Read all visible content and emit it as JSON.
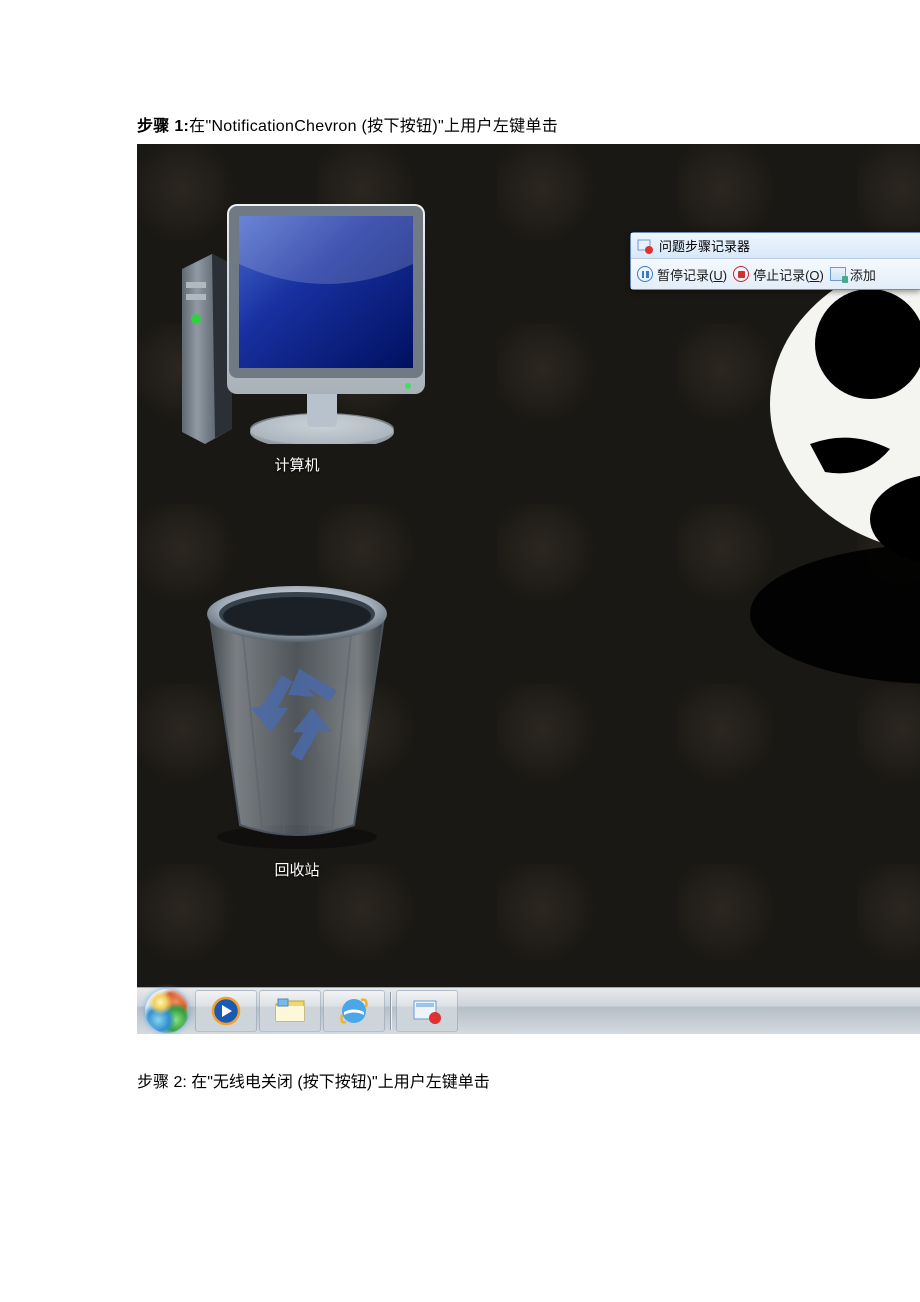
{
  "step1": {
    "prefix": "步骤 1:",
    "text": "在\"NotificationChevron (按下按钮)\"上用户左键单击"
  },
  "desktop": {
    "computer_label": "计算机",
    "recycle_label": "回收站"
  },
  "psr": {
    "title": "问题步骤记录器",
    "pause": "暂停记录(",
    "pause_key": "U",
    "pause_suffix": ")",
    "stop": "停止记录(",
    "stop_key": "O",
    "stop_suffix": ")",
    "add": "添加"
  },
  "step2": {
    "prefix": "步骤 2:",
    "text": " 在\"无线电关闭 (按下按钮)\"上用户左键单击"
  }
}
